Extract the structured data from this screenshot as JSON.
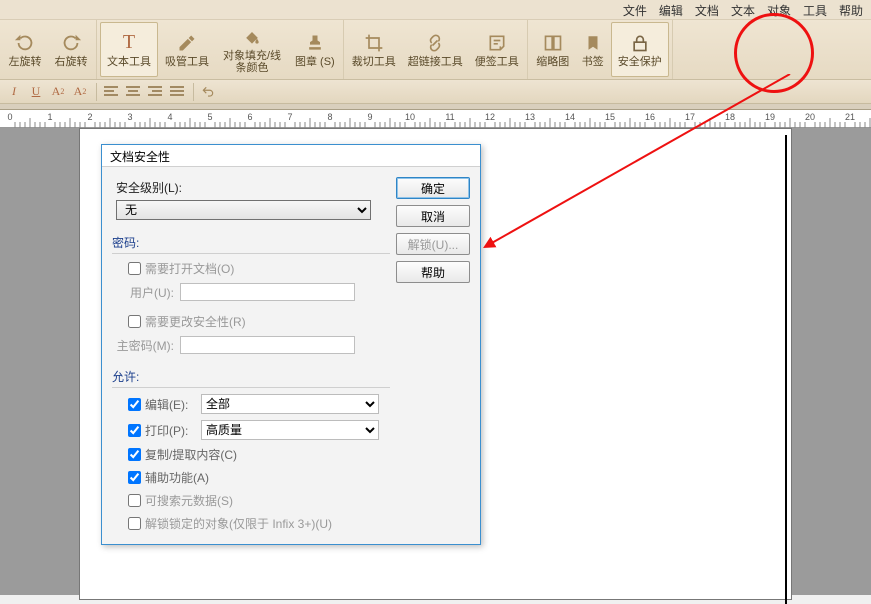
{
  "menubar": [
    "文件",
    "编辑",
    "文档",
    "文本",
    "对象",
    "工具",
    "帮助"
  ],
  "toolbar": {
    "rotate_left": "左旋转",
    "rotate_right": "右旋转",
    "text_tool": "文本工具",
    "eyedrop": "吸管工具",
    "fill_stroke": "对象填充/线条颜色",
    "stamp": "图章 (S)",
    "crop": "裁切工具",
    "link": "超链接工具",
    "sticky": "便签工具",
    "thumb": "缩略图",
    "bookmark": "书签",
    "security": "安全保护"
  },
  "dialog": {
    "title": "文档安全性",
    "level_label": "安全级别(L):",
    "level_value": "无",
    "ok": "确定",
    "cancel": "取消",
    "unlock": "解锁(U)...",
    "help": "帮助",
    "password_hd": "密码:",
    "need_open": "需要打开文档(O)",
    "user_lab": "用户(U):",
    "need_chg": "需要更改安全性(R)",
    "master_lab": "主密码(M):",
    "allow_hd": "允许:",
    "edit_lab": "编辑(E):",
    "edit_val": "全部",
    "print_lab": "打印(P):",
    "print_val": "高质量",
    "copy": "复制/提取内容(C)",
    "access": "辅助功能(A)",
    "meta": "可搜索元数据(S)",
    "unlock_objs": "解锁锁定的对象(仅限于 Infix 3+)(U)"
  },
  "ruler_max": 21
}
